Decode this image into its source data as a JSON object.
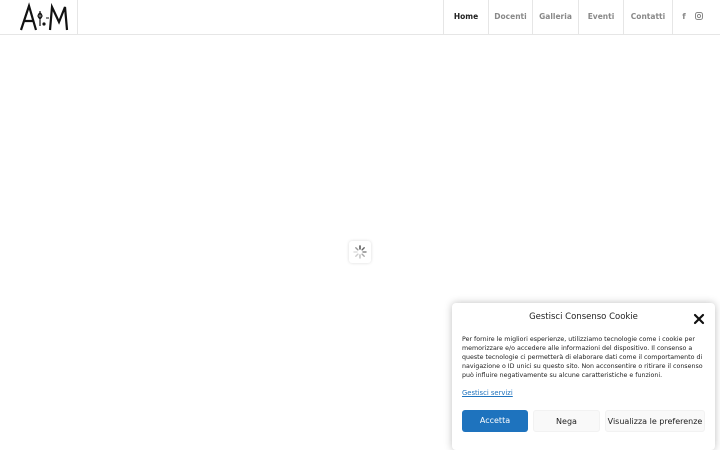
{
  "header": {
    "logo_alt": "A M",
    "nav": [
      {
        "label": "Home",
        "active": true
      },
      {
        "label": "Docenti",
        "active": false
      },
      {
        "label": "Galleria",
        "active": false
      },
      {
        "label": "Eventi",
        "active": false
      },
      {
        "label": "Contatti",
        "active": false
      }
    ],
    "social": [
      {
        "icon": "facebook-icon",
        "glyph": "f"
      },
      {
        "icon": "instagram-icon",
        "glyph": "◘"
      }
    ]
  },
  "loader": {
    "icon": "spinner-icon"
  },
  "cookie_banner": {
    "title": "Gestisci Consenso Cookie",
    "text": "Per fornire le migliori esperienze, utilizziamo tecnologie come i cookie per memorizzare e/o accedere alle informazioni del dispositivo. Il consenso a queste tecnologie ci permetterà di elaborare dati come il comportamento di navigazione o ID unici su questo sito. Non acconsentire o ritirare il consenso può influire negativamente su alcune caratteristiche e funzioni.",
    "manage_link": "Gestisci servizi",
    "accept_label": "Accetta",
    "deny_label": "Nega",
    "prefs_label": "Visualizza le preferenze",
    "accent_color": "#1e73be"
  }
}
